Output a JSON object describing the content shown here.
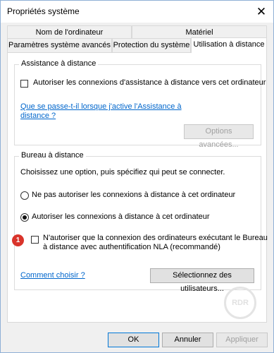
{
  "window": {
    "title": "Propriétés système",
    "close_symbol": "✕"
  },
  "tabs": {
    "row1": [
      "Nom de l'ordinateur",
      "Matériel"
    ],
    "row2": [
      "Paramètres système avancés",
      "Protection du système",
      "Utilisation à distance"
    ]
  },
  "assistance": {
    "legend": "Assistance à distance",
    "checkbox_label": "Autoriser les connexions d'assistance à distance vers cet ordinateur",
    "checked": false,
    "link_line1": "Que se passe-t-il lorsque j'active l'Assistance à",
    "link_line2": "distance ?",
    "advanced_button": "Options avancées..."
  },
  "remote_desktop": {
    "legend": "Bureau à distance",
    "instruction": "Choisissez une option, puis spécifiez qui peut se connecter.",
    "radio_deny": "Ne pas autoriser les connexions à distance à cet ordinateur",
    "radio_allow": "Autoriser les connexions à distance à cet ordinateur",
    "selected": "allow",
    "nla_line1": "N'autoriser que la connexion des ordinateurs exécutant le Bureau",
    "nla_line2": "à distance avec authentification NLA (recommandé)",
    "nla_checked": false,
    "badge": "1",
    "help_link": "Comment choisir ?",
    "select_users_button": "Sélectionnez des utilisateurs..."
  },
  "footer": {
    "ok": "OK",
    "cancel": "Annuler",
    "apply": "Appliquer"
  },
  "watermark": "RDR"
}
